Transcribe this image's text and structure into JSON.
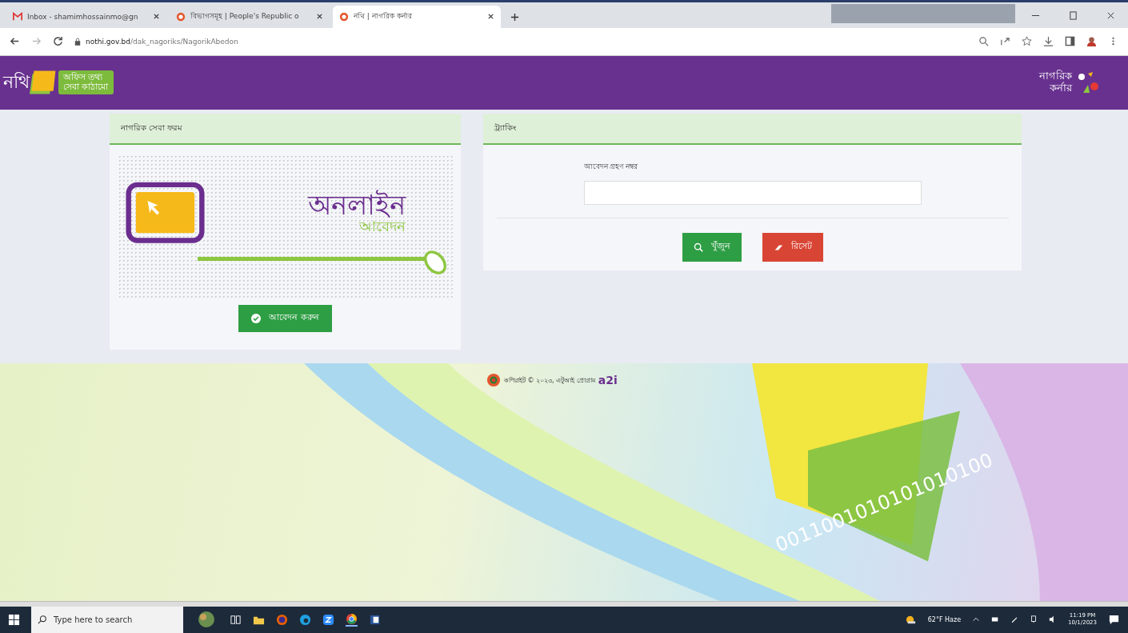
{
  "browser": {
    "tabs": [
      {
        "title": "Inbox - shamimhossainmo@gn",
        "selected": false,
        "kind": "mail"
      },
      {
        "title": "বিভাগসমূহ | People's Republic o",
        "selected": false,
        "kind": "site"
      },
      {
        "title": "নথি | নাগরিক কর্নার",
        "selected": true,
        "kind": "site"
      }
    ],
    "url": {
      "host": "nothi.gov.bd",
      "path": "/dak_nagoriks/NagorikAbedon"
    }
  },
  "header": {
    "logo_mark": "নথি",
    "logo_line1": "অফিস তথ্য",
    "logo_line2": "সেবা কাঠামো",
    "corner_line1": "নাগরিক",
    "corner_line2": "কর্নার"
  },
  "application_panel": {
    "title": "নাগরিক সেবা ফরম",
    "headline": "অনলাইন",
    "subline": "আবেদন",
    "button": "আবেদন করুন"
  },
  "tracking_panel": {
    "title": "ট্র্যাকিং",
    "field_label": "আবেদন গ্রহণ নম্বর",
    "buttons": [
      {
        "label": "খুঁজুন",
        "kind": "search"
      },
      {
        "label": "রিসেট",
        "kind": "reset"
      }
    ]
  },
  "footer": {
    "copyright": "কপিরাইট © ২০২৩, এটুআই প্রোগ্রাম",
    "brand": "a2i",
    "binary_text": "0011001010101010100"
  },
  "taskbar": {
    "search_placeholder": "Type here to search",
    "weather": "62°F Haze",
    "time": "11:19 PM",
    "date": "10/1/2023"
  }
}
